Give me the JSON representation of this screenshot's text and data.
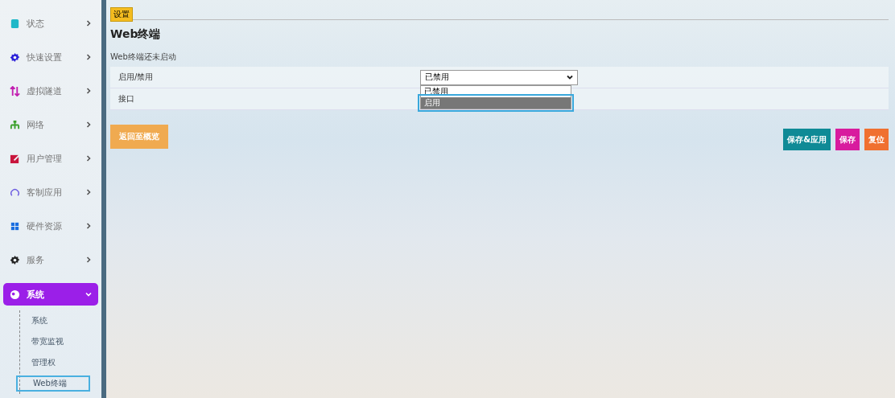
{
  "sidebar": {
    "items": [
      {
        "label": "状态",
        "color": "#1fb8c8",
        "expanded": false
      },
      {
        "label": "快速设置",
        "color": "#2a1fd8",
        "expanded": false
      },
      {
        "label": "虚拟隧道",
        "color": "#c21fb0",
        "expanded": false
      },
      {
        "label": "网络",
        "color": "#3aa02a",
        "expanded": false
      },
      {
        "label": "用户管理",
        "color": "#c8143c",
        "expanded": false
      },
      {
        "label": "客制应用",
        "color": "#6a5ae0",
        "expanded": false
      },
      {
        "label": "硬件资源",
        "color": "#1a6ee0",
        "expanded": false
      },
      {
        "label": "服务",
        "color": "#222222",
        "expanded": false
      },
      {
        "label": "系统",
        "color": "#ffffff",
        "expanded": true,
        "children": [
          {
            "label": "系统",
            "selected": false
          },
          {
            "label": "带宽监视",
            "selected": false
          },
          {
            "label": "管理权",
            "selected": false
          },
          {
            "label": "Web终端",
            "selected": true
          }
        ]
      }
    ]
  },
  "tabs": [
    {
      "label": "设置",
      "selected": true
    }
  ],
  "title": "Web终端",
  "status_text": "Web终端还未启动",
  "form": {
    "rows": [
      {
        "label": "启用/禁用",
        "kind": "select",
        "value": "已禁用",
        "options": [
          {
            "label": "已禁用",
            "highlighted": false
          },
          {
            "label": "启用",
            "highlighted": true
          }
        ]
      },
      {
        "label": "接口",
        "kind": "text"
      }
    ]
  },
  "back_button": "返回至概览",
  "actions": [
    {
      "label": "保存&应用",
      "color": "#0f8a96"
    },
    {
      "label": "保存",
      "color": "#d81b9e"
    },
    {
      "label": "复位",
      "color": "#f07030"
    }
  ]
}
